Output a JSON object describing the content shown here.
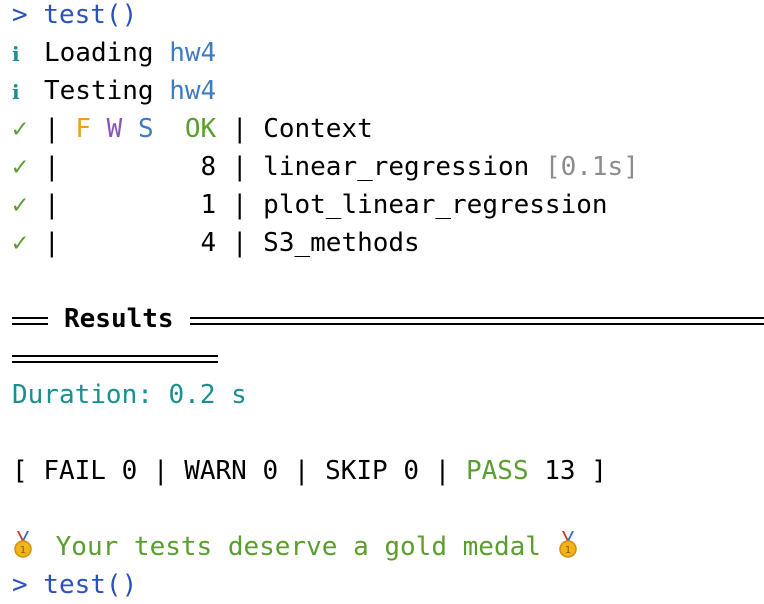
{
  "prompt": ">",
  "command": "test()",
  "loading": {
    "icon": "i",
    "verb": "Loading",
    "pkg": "hw4"
  },
  "testing": {
    "icon": "i",
    "verb": "Testing",
    "pkg": "hw4"
  },
  "table": {
    "header": {
      "check": "✓",
      "sep": "|",
      "f": "F",
      "w": "W",
      "s": "S",
      "ok": "OK",
      "context": "Context"
    },
    "rows": [
      {
        "check": "✓",
        "ok": "8",
        "context": "linear_regression",
        "time": "[0.1s]"
      },
      {
        "check": "✓",
        "ok": "1",
        "context": "plot_linear_regression",
        "time": ""
      },
      {
        "check": "✓",
        "ok": "4",
        "context": "S3_methods",
        "time": ""
      }
    ]
  },
  "results": {
    "title": "Results",
    "duration": "Duration: 0.2 s",
    "summary": {
      "open": "[",
      "fail": "FAIL 0",
      "warn": "WARN 0",
      "skip": "SKIP 0",
      "pass_label": "PASS",
      "pass_count": "13",
      "close": "]"
    },
    "praise": "Your tests deserve a gold medal"
  },
  "next_prompt": "> test()",
  "colors": {
    "blue": "#2a52be",
    "teal": "#1a8f8f",
    "green": "#5a9e2f",
    "orange": "#e8a21a",
    "purple": "#8a55b8",
    "gray": "#8c8c8c"
  },
  "icons": [
    "info-icon",
    "check-icon",
    "gold-medal-icon"
  ]
}
